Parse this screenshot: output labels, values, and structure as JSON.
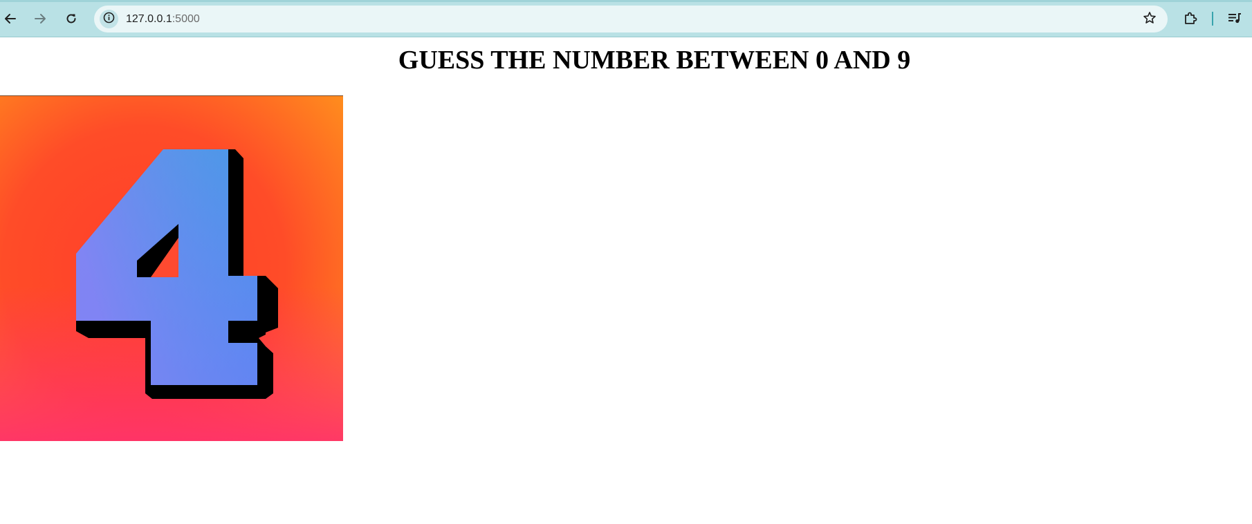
{
  "browser": {
    "url_host": "127.0.0.1",
    "url_port": ":5000",
    "icons": {
      "back": "back-arrow-icon",
      "forward": "forward-arrow-icon",
      "reload": "reload-icon",
      "site_info": "info-icon",
      "bookmark": "star-icon",
      "extensions": "puzzle-icon",
      "media": "media-queue-icon"
    },
    "colors": {
      "toolbar": "#b9e1e5",
      "omnibox": "#eaf6f7"
    }
  },
  "page": {
    "title": "GUESS THE NUMBER BETWEEN 0 AND 9",
    "image": {
      "digit": "4",
      "colors": {
        "background_top": "#ff8a1e",
        "background_bottom": "#ff2f6e",
        "digit_light": "#7b7ff6",
        "digit_dark": "#3fa3e0",
        "outline": "#000000"
      }
    }
  }
}
